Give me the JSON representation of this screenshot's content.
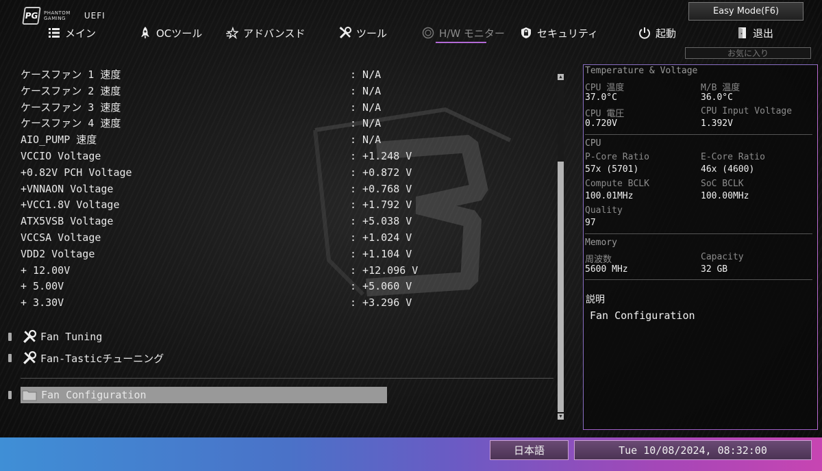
{
  "header": {
    "brand_line1": "PHANTOM",
    "brand_line2": "GAMING",
    "logo_mark": "PG",
    "uefi_label": "UEFI",
    "easy_mode_label": "Easy Mode(F6)",
    "favorites_label": "お気に入り"
  },
  "nav": [
    {
      "label": "メイン",
      "icon": "list-icon"
    },
    {
      "label": "OCツール",
      "icon": "rocket-icon"
    },
    {
      "label": "アドバンスド",
      "icon": "star-icon"
    },
    {
      "label": "ツール",
      "icon": "tools-icon"
    },
    {
      "label": "H/W モニター",
      "icon": "monitor-icon",
      "active": true
    },
    {
      "label": "セキュリティ",
      "icon": "shield-icon"
    },
    {
      "label": "起動",
      "icon": "power-icon"
    },
    {
      "label": "退出",
      "icon": "exit-icon"
    }
  ],
  "readings": [
    {
      "label": "ケースファン 1 速度",
      "value": ": N/A"
    },
    {
      "label": "ケースファン 2 速度",
      "value": ": N/A"
    },
    {
      "label": "ケースファン 3 速度",
      "value": ": N/A"
    },
    {
      "label": "ケースファン 4 速度",
      "value": ": N/A"
    },
    {
      "label": "AIO_PUMP 速度",
      "value": ": N/A"
    },
    {
      "label": "VCCIO Voltage",
      "value": ": +1.248 V"
    },
    {
      "label": "+0.82V PCH Voltage",
      "value": ": +0.872 V"
    },
    {
      "label": "+VNNAON Voltage",
      "value": ": +0.768 V"
    },
    {
      "label": "+VCC1.8V Voltage",
      "value": ": +1.792 V"
    },
    {
      "label": "ATX5VSB Voltage",
      "value": ": +5.038 V"
    },
    {
      "label": "VCCSA Voltage",
      "value": ": +1.024 V"
    },
    {
      "label": "VDD2 Voltage",
      "value": ": +1.104 V"
    },
    {
      "label": "+ 12.00V",
      "value": ": +12.096 V"
    },
    {
      "label": "+ 5.00V",
      "value": ": +5.060 V"
    },
    {
      "label": "+ 3.30V",
      "value": ": +3.296 V"
    }
  ],
  "menus": [
    {
      "label": "Fan Tuning",
      "icon": "tools-icon"
    },
    {
      "label": "Fan-Tasticチューニング",
      "icon": "tools-icon"
    }
  ],
  "selected_menu": {
    "label": "Fan Configuration",
    "icon": "folder-icon"
  },
  "panel": {
    "tv_title": "Temperature & Voltage",
    "cpu_temp_label": "CPU 温度",
    "cpu_temp": "37.0°C",
    "mb_temp_label": "M/B 温度",
    "mb_temp": "36.0°C",
    "cpu_volt_label": "CPU 電圧",
    "cpu_volt": "0.720V",
    "cpu_input_label": "CPU Input Voltage",
    "cpu_input": "1.392V",
    "cpu_title": "CPU",
    "pcore_label": "P-Core Ratio",
    "pcore": "57x (5701)",
    "ecore_label": "E-Core Ratio",
    "ecore": "46x (4600)",
    "cbclk_label": "Compute BCLK",
    "cbclk": "100.01MHz",
    "socbclk_label": "SoC BCLK",
    "socbclk": "100.00MHz",
    "quality_label": "Quality",
    "quality": "97",
    "mem_title": "Memory",
    "freq_label": "周波数",
    "freq": "5600 MHz",
    "cap_label": "Capacity",
    "cap": "32 GB",
    "desc_title": "説明",
    "desc_text": "Fan Configuration"
  },
  "footer": {
    "language": "日本語",
    "datetime": "Tue 10/08/2024, 08:32:00"
  }
}
